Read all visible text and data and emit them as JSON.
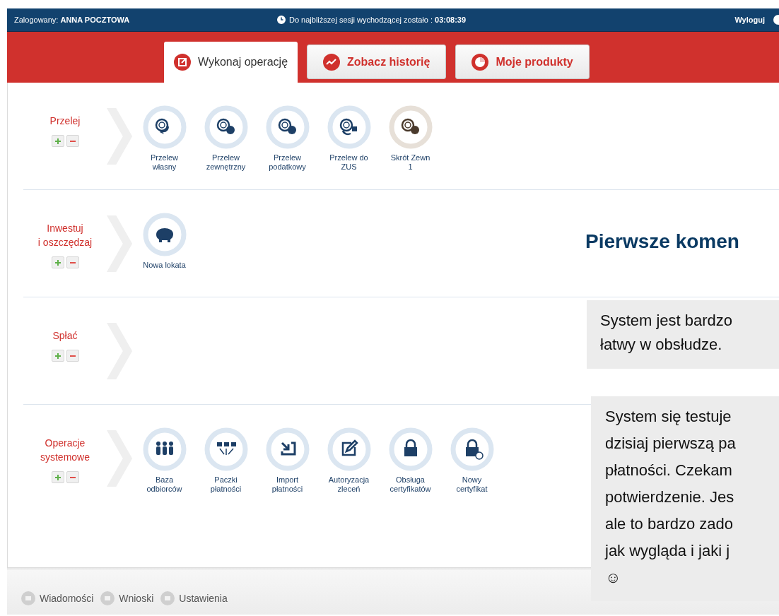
{
  "topbar": {
    "user_label": "Zalogowany:",
    "user_name": "ANNA POCZTOWA",
    "session_label": "Do najbliższej sesji wychodzącej zostało :",
    "session_time": "03:08:39",
    "logout": "Wyloguj"
  },
  "tabs": [
    {
      "label": "Wykonaj operację",
      "selected": true
    },
    {
      "label": "Zobacz historię",
      "selected": false
    },
    {
      "label": "Moje produkty",
      "selected": false
    }
  ],
  "sections": [
    {
      "label": "Przelej",
      "items": [
        {
          "label": "Przelew własny",
          "kind": "operation"
        },
        {
          "label": "Przelew zewnętrzny",
          "kind": "operation"
        },
        {
          "label": "Przelew podatkowy",
          "kind": "operation"
        },
        {
          "label": "Przelew do ZUS",
          "kind": "operation"
        },
        {
          "label": "Skrót Zewn 1",
          "kind": "shortcut"
        }
      ]
    },
    {
      "label": "Inwestuj\ni oszczędzaj",
      "items": [
        {
          "label": "Nowa lokata",
          "kind": "operation"
        }
      ]
    },
    {
      "label": "Spłać"
    },
    {
      "label": "Operacje\nsystemowe",
      "items": [
        {
          "label": "Baza odbiorców",
          "kind": "operation"
        },
        {
          "label": "Paczki płatności",
          "kind": "operation"
        },
        {
          "label": "Import płatności",
          "kind": "operation"
        },
        {
          "label": "Autoryzacja zleceń",
          "kind": "operation"
        },
        {
          "label": "Obsługa certyfikatów",
          "kind": "operation"
        },
        {
          "label": "Nowy certyfikat",
          "kind": "operation"
        }
      ]
    }
  ],
  "footer": [
    {
      "label": "Wiadomości"
    },
    {
      "label": "Wnioski"
    },
    {
      "label": "Ustawienia"
    }
  ],
  "overlay": {
    "heading": "Pierwsze komen",
    "notes": [
      {
        "lines": [
          "System jest bardzo",
          "łatwy w obsłudze."
        ]
      },
      {
        "lines": [
          "System się testuje",
          "dzisiaj pierwszą pa",
          "płatności. Czekam",
          "potwierdzenie. Jes",
          "ale to bardzo zado",
          "jak wygląda i jaki j",
          "☺"
        ]
      }
    ]
  }
}
